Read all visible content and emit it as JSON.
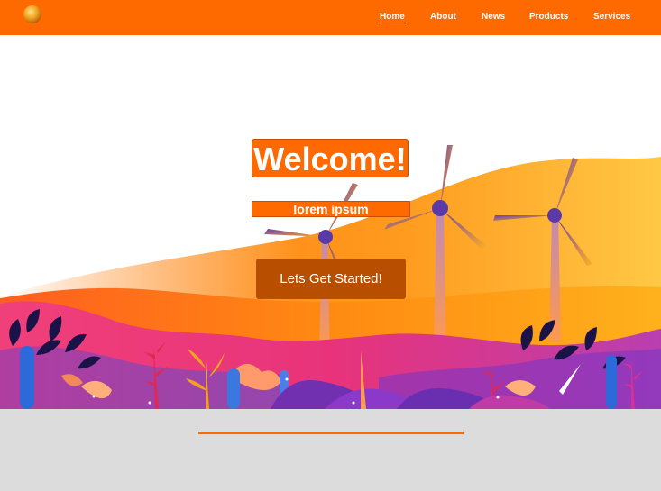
{
  "nav": {
    "logo_icon": "globe-logo-icon",
    "links": [
      {
        "label": "Home",
        "active": true
      },
      {
        "label": "About",
        "active": false
      },
      {
        "label": "News",
        "active": false
      },
      {
        "label": "Products",
        "active": false
      },
      {
        "label": "Services",
        "active": false
      }
    ]
  },
  "hero": {
    "title": "Welcome!",
    "subtitle": "lorem ipsum",
    "cta_label": "Lets Get Started!",
    "illustration_icon": "wind-turbines-landscape-illustration"
  },
  "colors": {
    "brand": "#ff6a00",
    "cta": "#b84e00",
    "footer_bg": "#dcdcdc"
  }
}
